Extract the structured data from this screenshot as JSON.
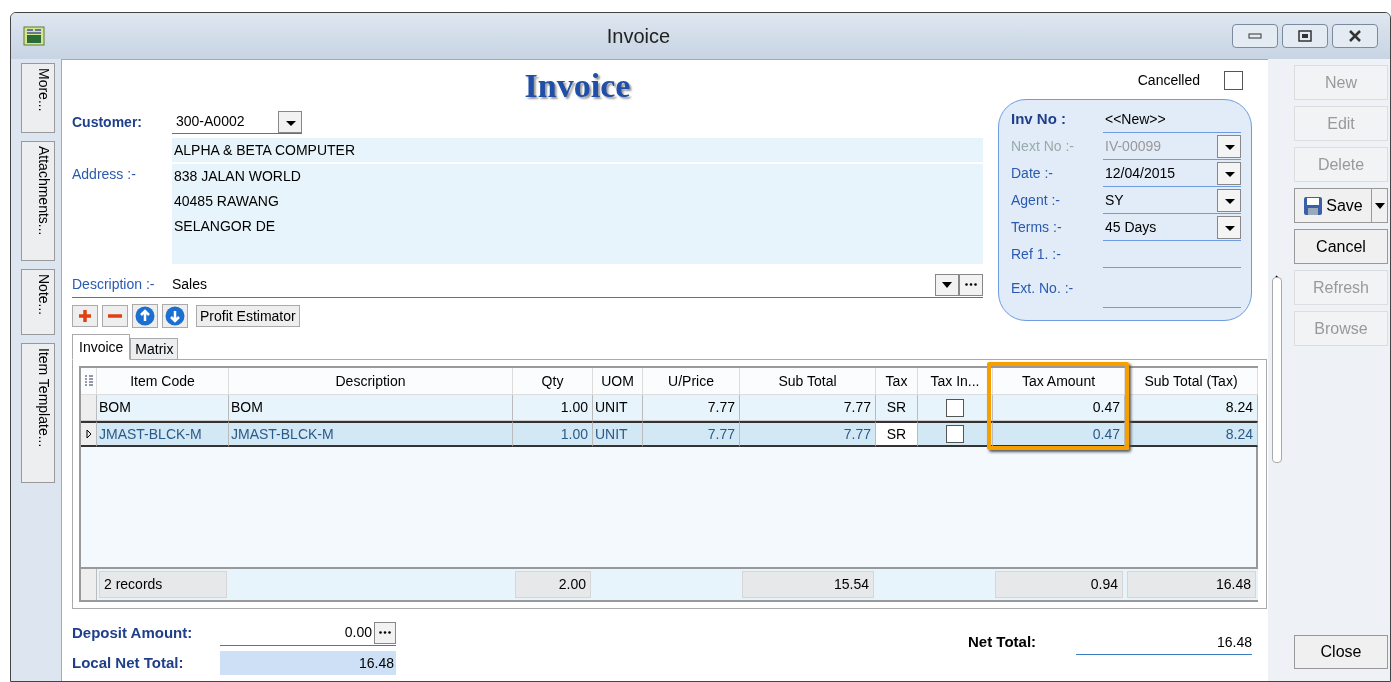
{
  "window": {
    "title": "Invoice"
  },
  "side_tabs": [
    "More...",
    "Attachments...",
    "Note...",
    "Item Template..."
  ],
  "heading": "Invoice",
  "cancelled": {
    "label": "Cancelled",
    "checked": false
  },
  "customer": {
    "label": "Customer:",
    "value": "300-A0002"
  },
  "company_name": "ALPHA & BETA COMPUTER",
  "address": {
    "label": "Address :-",
    "lines": [
      "838 JALAN WORLD",
      "40485 RAWANG",
      "SELANGOR DE"
    ]
  },
  "description": {
    "label": "Description :-",
    "value": "Sales"
  },
  "doc_fields": [
    {
      "label": "Inv No :",
      "value": "<<New>>",
      "kind": "title",
      "disabled": false
    },
    {
      "label": "Next No :-",
      "value": "IV-00099",
      "kind": "dropdown",
      "disabled": true
    },
    {
      "label": "Date :-",
      "value": "12/04/2015",
      "kind": "dropdown",
      "disabled": false
    },
    {
      "label": "Agent :-",
      "value": "SY",
      "kind": "dropdown",
      "disabled": false
    },
    {
      "label": "Terms :-",
      "value": "45 Days",
      "kind": "dropdown",
      "disabled": false
    },
    {
      "label": "Ref 1. :-",
      "kind": "text",
      "disabled": false
    },
    {
      "label": "Ext. No. :-",
      "kind": "text",
      "disabled": false
    }
  ],
  "toolbar": {
    "profit_button": "Profit Estimator"
  },
  "tabs": [
    {
      "label": "Invoice",
      "selected": true
    },
    {
      "label": "Matrix",
      "selected": false
    }
  ],
  "table": {
    "columns": [
      {
        "label": "Item Code",
        "highlighted": false
      },
      {
        "label": "Description",
        "highlighted": false
      },
      {
        "label": "Qty",
        "highlighted": false
      },
      {
        "label": "UOM",
        "highlighted": false
      },
      {
        "label": "U/Price",
        "highlighted": false
      },
      {
        "label": "Sub Total",
        "highlighted": false
      },
      {
        "label": "Tax",
        "highlighted": false
      },
      {
        "label": "Tax In...",
        "highlighted": false
      },
      {
        "label": "Tax Amount",
        "highlighted": true
      },
      {
        "label": "Sub Total (Tax)",
        "highlighted": false
      }
    ],
    "rows": [
      {
        "selected": false,
        "item_code": "BOM",
        "description": "BOM",
        "qty": "1.00",
        "uom": "UNIT",
        "unit_price": "7.77",
        "sub_total": "7.77",
        "tax": "SR",
        "tax_inclusive": false,
        "tax_amount": "0.47",
        "sub_total_tax": "8.24"
      },
      {
        "selected": true,
        "item_code": "JMAST-BLCK-M",
        "description": "JMAST-BLCK-M",
        "qty": "1.00",
        "uom": "UNIT",
        "unit_price": "7.77",
        "sub_total": "7.77",
        "tax": "SR",
        "tax_inclusive": false,
        "tax_amount": "0.47",
        "sub_total_tax": "8.24"
      }
    ],
    "footer": {
      "records": "2 records",
      "qty": "2.00",
      "sub_total": "15.54",
      "tax_amount": "0.94",
      "sub_total_tax": "16.48"
    }
  },
  "deposit": {
    "label": "Deposit Amount:",
    "value": "0.00"
  },
  "local_net_total": {
    "label": "Local Net Total:",
    "value": "16.48"
  },
  "net_total": {
    "label": "Net Total:",
    "value": "16.48"
  },
  "buttons": [
    {
      "label": "New",
      "kind": "plain",
      "disabled": true
    },
    {
      "label": "Edit",
      "kind": "plain",
      "disabled": true
    },
    {
      "label": "Delete",
      "kind": "plain",
      "disabled": true
    },
    {
      "label": "Save",
      "kind": "split",
      "disabled": false
    },
    {
      "label": "Cancel",
      "kind": "plain",
      "disabled": false
    },
    {
      "label": "Refresh",
      "kind": "plain",
      "disabled": true
    },
    {
      "label": "Browse",
      "kind": "plain",
      "disabled": true
    },
    {
      "label": "Close",
      "kind": "bottom",
      "disabled": false
    }
  ]
}
